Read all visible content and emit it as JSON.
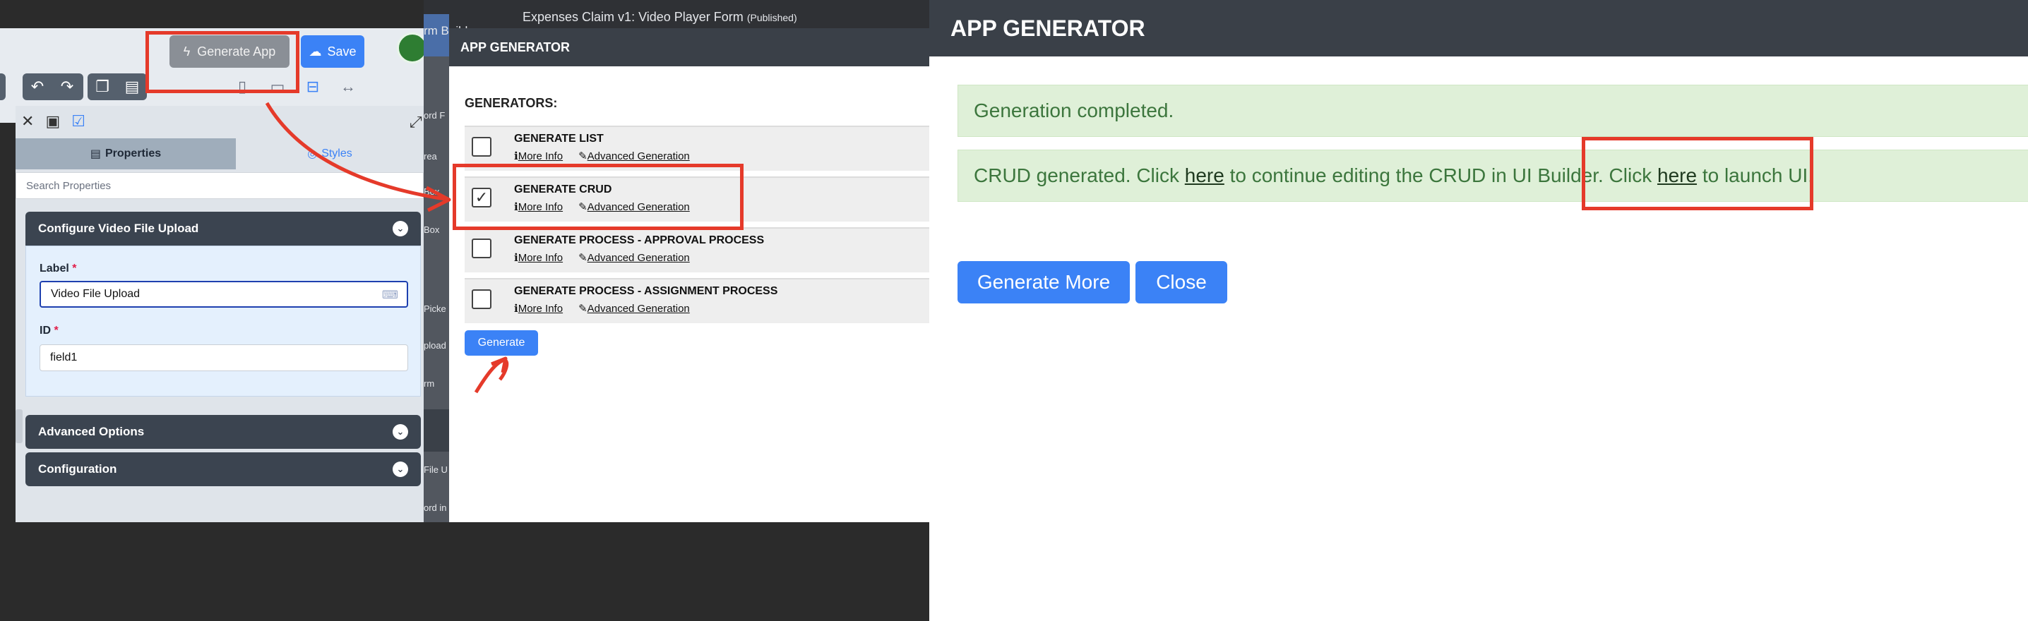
{
  "builder": {
    "header_text": "Expenses Claim v1: Video Player Form",
    "header_status": "(Published)",
    "generate_app_label": "Generate App",
    "save_label": "Save",
    "side_labels": [
      "rm Builder",
      "ord F",
      "rea",
      "Box",
      "Box",
      "Picke",
      "pload",
      "rm",
      "File U",
      "ord in"
    ],
    "tab_properties": "Properties",
    "tab_styles": "Styles",
    "search_placeholder": "Search Properties",
    "section_title": "Configure Video File Upload",
    "label_field_label": "Label",
    "label_field_value": "Video File Upload",
    "id_field_label": "ID",
    "id_field_value": "field1",
    "required_mark": "*",
    "advanced_options": "Advanced Options",
    "configuration": "Configuration"
  },
  "dialog": {
    "title": "APP GENERATOR",
    "generators_label": "GENERATORS:",
    "more_info": "More Info",
    "advanced_generation": "Advanced Generation",
    "items": [
      {
        "title": "GENERATE LIST",
        "checked": false
      },
      {
        "title": "GENERATE CRUD",
        "checked": true
      },
      {
        "title": "GENERATE PROCESS - APPROVAL PROCESS",
        "checked": false
      },
      {
        "title": "GENERATE PROCESS - ASSIGNMENT PROCESS",
        "checked": false
      }
    ],
    "generate_label": "Generate"
  },
  "result": {
    "title": "APP GENERATOR",
    "completed_text": "Generation completed.",
    "crud_text_1": "CRUD generated. Click ",
    "crud_link_1": "here",
    "crud_text_2": " to continue editing the CRUD in UI Builder. Click ",
    "crud_link_2": "here",
    "crud_text_3": " to launch UI.",
    "generate_more_label": "Generate More",
    "close_label": "Close"
  },
  "colors": {
    "accent": "#3b82f6",
    "header_dark": "#3a4048",
    "annotation_red": "#e53a2a",
    "success_bg": "#dff0d8",
    "success_text": "#3c763d"
  }
}
